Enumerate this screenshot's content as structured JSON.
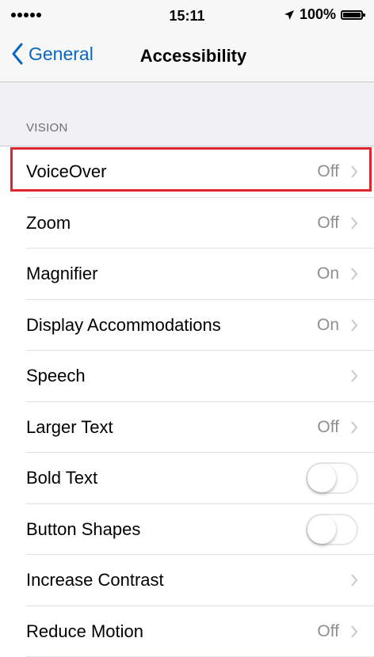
{
  "status_bar": {
    "time": "15:11",
    "battery": "100%",
    "signal_icon": "signal-dots-icon",
    "location_icon": "location-arrow-icon"
  },
  "nav": {
    "back_label": "General",
    "title": "Accessibility"
  },
  "section": {
    "header": "VISION"
  },
  "rows": [
    {
      "label": "VoiceOver",
      "value": "Off",
      "type": "disclosure",
      "highlighted": true
    },
    {
      "label": "Zoom",
      "value": "Off",
      "type": "disclosure"
    },
    {
      "label": "Magnifier",
      "value": "On",
      "type": "disclosure"
    },
    {
      "label": "Display Accommodations",
      "value": "On",
      "type": "disclosure"
    },
    {
      "label": "Speech",
      "value": "",
      "type": "disclosure"
    },
    {
      "label": "Larger Text",
      "value": "Off",
      "type": "disclosure"
    },
    {
      "label": "Bold Text",
      "type": "toggle",
      "on": false
    },
    {
      "label": "Button Shapes",
      "type": "toggle",
      "on": false
    },
    {
      "label": "Increase Contrast",
      "value": "",
      "type": "disclosure"
    },
    {
      "label": "Reduce Motion",
      "value": "Off",
      "type": "disclosure"
    }
  ],
  "colors": {
    "accent": "#0a66c2",
    "highlight": "#e0262c",
    "secondary_text": "#8e8e93",
    "grouped_bg": "#efeff4"
  }
}
